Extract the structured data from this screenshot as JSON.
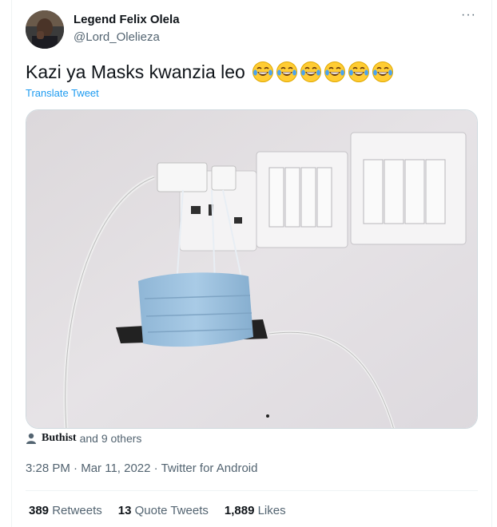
{
  "author": {
    "name": "Legend Felix Olela",
    "handle": "@Lord_Olelieza"
  },
  "more_label": "···",
  "tweet": {
    "text": "Kazi ya Masks kwanzia leo",
    "emoji_count": 6,
    "translate_label": "Translate Tweet"
  },
  "liked_by": {
    "name": "Buthist",
    "rest": "and 9 others"
  },
  "meta": {
    "time": "3:28 PM",
    "sep1": "·",
    "date": "Mar 11, 2022",
    "sep2": "·",
    "source": "Twitter for Android"
  },
  "stats": [
    {
      "count": "389",
      "label": "Retweets"
    },
    {
      "count": "13",
      "label": "Quote Tweets"
    },
    {
      "count": "1,889",
      "label": "Likes"
    }
  ],
  "colors": {
    "link": "#1d9bf0",
    "secondary_text": "#536471",
    "divider": "#eff3f4"
  },
  "icons": [
    "more-dots-icon",
    "laughing-emoji-icon",
    "person-icon"
  ]
}
